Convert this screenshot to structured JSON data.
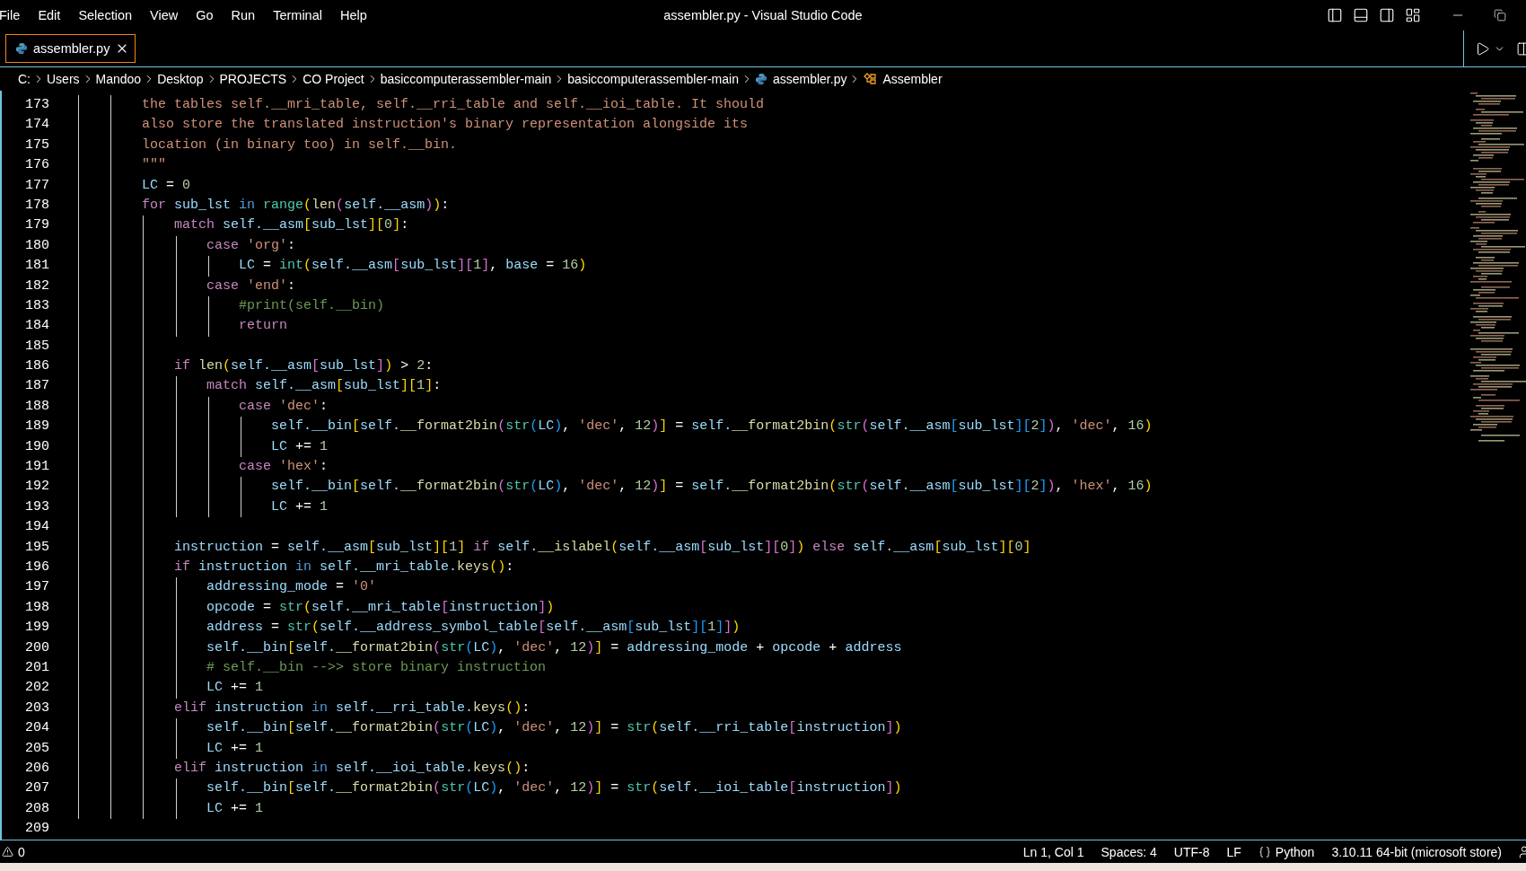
{
  "window": {
    "title": "assembler.py - Visual Studio Code"
  },
  "menu": [
    "File",
    "Edit",
    "Selection",
    "View",
    "Go",
    "Run",
    "Terminal",
    "Help"
  ],
  "tabs": [
    {
      "label": "assembler.py",
      "selected": true
    }
  ],
  "breadcrumb": [
    {
      "label": "C:",
      "kind": "folder"
    },
    {
      "label": "Users",
      "kind": "folder"
    },
    {
      "label": "Mandoo",
      "kind": "folder"
    },
    {
      "label": "Desktop",
      "kind": "folder"
    },
    {
      "label": "PROJECTS",
      "kind": "folder"
    },
    {
      "label": "CO Project",
      "kind": "folder"
    },
    {
      "label": "basiccomputerassembler-main",
      "kind": "folder"
    },
    {
      "label": "basiccomputerassembler-main",
      "kind": "folder"
    },
    {
      "label": "assembler.py",
      "kind": "file"
    },
    {
      "label": "Assembler",
      "kind": "class"
    }
  ],
  "editor": {
    "lines": [
      {
        "number": "173",
        "tokens": [
          {
            "kind": "doc",
            "text": "        the tables self.__mri_table, self.__rri_table and self.__ioi_table. It should"
          }
        ]
      },
      {
        "number": "174",
        "tokens": [
          {
            "kind": "doc",
            "text": "        also store the translated instruction's binary representation alongside its"
          }
        ]
      },
      {
        "number": "175",
        "tokens": [
          {
            "kind": "doc",
            "text": "        location (in binary too) in self.__bin."
          }
        ]
      },
      {
        "number": "176",
        "tokens": [
          {
            "kind": "doc",
            "text": "        \"\"\""
          }
        ]
      },
      {
        "number": "177",
        "tokens": [
          {
            "kind": "var",
            "text": "        LC"
          },
          {
            "kind": "p",
            "text": " = "
          },
          {
            "kind": "num",
            "text": "0"
          }
        ]
      },
      {
        "number": "178",
        "tokens": [
          {
            "kind": "kw",
            "text": "        for"
          },
          {
            "kind": "var",
            "text": " sub_lst "
          },
          {
            "kind": "in",
            "text": "in"
          },
          {
            "kind": "cls",
            "text": " range"
          },
          {
            "kind": "b1",
            "text": "("
          },
          {
            "kind": "fn",
            "text": "len"
          },
          {
            "kind": "b2",
            "text": "("
          },
          {
            "kind": "var",
            "text": "self.__asm"
          },
          {
            "kind": "b2",
            "text": ")"
          },
          {
            "kind": "b1",
            "text": ")"
          },
          {
            "kind": "p",
            "text": ":"
          }
        ]
      },
      {
        "number": "179",
        "tokens": [
          {
            "kind": "kw",
            "text": "            match"
          },
          {
            "kind": "var",
            "text": " self.__asm"
          },
          {
            "kind": "b1",
            "text": "["
          },
          {
            "kind": "var",
            "text": "sub_lst"
          },
          {
            "kind": "b1",
            "text": "]["
          },
          {
            "kind": "num",
            "text": "0"
          },
          {
            "kind": "b1",
            "text": "]"
          },
          {
            "kind": "p",
            "text": ":"
          }
        ]
      },
      {
        "number": "180",
        "tokens": [
          {
            "kind": "kw",
            "text": "                case"
          },
          {
            "kind": "str",
            "text": " 'org'"
          },
          {
            "kind": "p",
            "text": ":"
          }
        ]
      },
      {
        "number": "181",
        "tokens": [
          {
            "kind": "var",
            "text": "                    LC"
          },
          {
            "kind": "p",
            "text": " = "
          },
          {
            "kind": "cls",
            "text": "int"
          },
          {
            "kind": "b1",
            "text": "("
          },
          {
            "kind": "var",
            "text": "self.__asm"
          },
          {
            "kind": "b2",
            "text": "["
          },
          {
            "kind": "var",
            "text": "sub_lst"
          },
          {
            "kind": "b2",
            "text": "]["
          },
          {
            "kind": "num",
            "text": "1"
          },
          {
            "kind": "b2",
            "text": "]"
          },
          {
            "kind": "p",
            "text": ", "
          },
          {
            "kind": "var",
            "text": "base"
          },
          {
            "kind": "p",
            "text": " = "
          },
          {
            "kind": "num",
            "text": "16"
          },
          {
            "kind": "b1",
            "text": ")"
          }
        ]
      },
      {
        "number": "182",
        "tokens": [
          {
            "kind": "kw",
            "text": "                case"
          },
          {
            "kind": "str",
            "text": " 'end'"
          },
          {
            "kind": "p",
            "text": ":"
          }
        ]
      },
      {
        "number": "183",
        "tokens": [
          {
            "kind": "com",
            "text": "                    #print(self.__bin)"
          }
        ]
      },
      {
        "number": "184",
        "tokens": [
          {
            "kind": "kw",
            "text": "                    return"
          }
        ]
      },
      {
        "number": "185"
      },
      {
        "number": "186",
        "tokens": [
          {
            "kind": "kw",
            "text": "            if"
          },
          {
            "kind": "fn",
            "text": " len"
          },
          {
            "kind": "b1",
            "text": "("
          },
          {
            "kind": "var",
            "text": "self.__asm"
          },
          {
            "kind": "b2",
            "text": "["
          },
          {
            "kind": "var",
            "text": "sub_lst"
          },
          {
            "kind": "b2",
            "text": "]"
          },
          {
            "kind": "b1",
            "text": ")"
          },
          {
            "kind": "p",
            "text": " > "
          },
          {
            "kind": "num",
            "text": "2"
          },
          {
            "kind": "p",
            "text": ":"
          }
        ]
      },
      {
        "number": "187",
        "tokens": [
          {
            "kind": "kw",
            "text": "                match"
          },
          {
            "kind": "var",
            "text": " self.__asm"
          },
          {
            "kind": "b1",
            "text": "["
          },
          {
            "kind": "var",
            "text": "sub_lst"
          },
          {
            "kind": "b1",
            "text": "]["
          },
          {
            "kind": "num",
            "text": "1"
          },
          {
            "kind": "b1",
            "text": "]"
          },
          {
            "kind": "p",
            "text": ":"
          }
        ]
      },
      {
        "number": "188",
        "tokens": [
          {
            "kind": "kw",
            "text": "                    case"
          },
          {
            "kind": "str",
            "text": " 'dec'"
          },
          {
            "kind": "p",
            "text": ":"
          }
        ]
      },
      {
        "number": "189",
        "tokens": [
          {
            "kind": "var",
            "text": "                        self.__bin"
          },
          {
            "kind": "b1",
            "text": "["
          },
          {
            "kind": "var",
            "text": "self."
          },
          {
            "kind": "fn",
            "text": "__format2bin"
          },
          {
            "kind": "b2",
            "text": "("
          },
          {
            "kind": "cls",
            "text": "str"
          },
          {
            "kind": "b3",
            "text": "("
          },
          {
            "kind": "var",
            "text": "LC"
          },
          {
            "kind": "b3",
            "text": ")"
          },
          {
            "kind": "p",
            "text": ", "
          },
          {
            "kind": "str",
            "text": "'dec'"
          },
          {
            "kind": "p",
            "text": ", "
          },
          {
            "kind": "num",
            "text": "12"
          },
          {
            "kind": "b2",
            "text": ")"
          },
          {
            "kind": "b1",
            "text": "]"
          },
          {
            "kind": "p",
            "text": " = "
          },
          {
            "kind": "var",
            "text": "self."
          },
          {
            "kind": "fn",
            "text": "__format2bin"
          },
          {
            "kind": "b1",
            "text": "("
          },
          {
            "kind": "cls",
            "text": "str"
          },
          {
            "kind": "b2",
            "text": "("
          },
          {
            "kind": "var",
            "text": "self.__asm"
          },
          {
            "kind": "b3",
            "text": "["
          },
          {
            "kind": "var",
            "text": "sub_lst"
          },
          {
            "kind": "b3",
            "text": "]["
          },
          {
            "kind": "num",
            "text": "2"
          },
          {
            "kind": "b3",
            "text": "]"
          },
          {
            "kind": "b2",
            "text": ")"
          },
          {
            "kind": "p",
            "text": ", "
          },
          {
            "kind": "str",
            "text": "'dec'"
          },
          {
            "kind": "p",
            "text": ", "
          },
          {
            "kind": "num",
            "text": "16"
          },
          {
            "kind": "b1",
            "text": ")"
          }
        ]
      },
      {
        "number": "190",
        "tokens": [
          {
            "kind": "var",
            "text": "                        LC"
          },
          {
            "kind": "p",
            "text": " += "
          },
          {
            "kind": "num",
            "text": "1"
          }
        ]
      },
      {
        "number": "191",
        "tokens": [
          {
            "kind": "kw",
            "text": "                    case"
          },
          {
            "kind": "str",
            "text": " 'hex'"
          },
          {
            "kind": "p",
            "text": ":"
          }
        ]
      },
      {
        "number": "192",
        "tokens": [
          {
            "kind": "var",
            "text": "                        self.__bin"
          },
          {
            "kind": "b1",
            "text": "["
          },
          {
            "kind": "var",
            "text": "self."
          },
          {
            "kind": "fn",
            "text": "__format2bin"
          },
          {
            "kind": "b2",
            "text": "("
          },
          {
            "kind": "cls",
            "text": "str"
          },
          {
            "kind": "b3",
            "text": "("
          },
          {
            "kind": "var",
            "text": "LC"
          },
          {
            "kind": "b3",
            "text": ")"
          },
          {
            "kind": "p",
            "text": ", "
          },
          {
            "kind": "str",
            "text": "'dec'"
          },
          {
            "kind": "p",
            "text": ", "
          },
          {
            "kind": "num",
            "text": "12"
          },
          {
            "kind": "b2",
            "text": ")"
          },
          {
            "kind": "b1",
            "text": "]"
          },
          {
            "kind": "p",
            "text": " = "
          },
          {
            "kind": "var",
            "text": "self."
          },
          {
            "kind": "fn",
            "text": "__format2bin"
          },
          {
            "kind": "b1",
            "text": "("
          },
          {
            "kind": "cls",
            "text": "str"
          },
          {
            "kind": "b2",
            "text": "("
          },
          {
            "kind": "var",
            "text": "self.__asm"
          },
          {
            "kind": "b3",
            "text": "["
          },
          {
            "kind": "var",
            "text": "sub_lst"
          },
          {
            "kind": "b3",
            "text": "]["
          },
          {
            "kind": "num",
            "text": "2"
          },
          {
            "kind": "b3",
            "text": "]"
          },
          {
            "kind": "b2",
            "text": ")"
          },
          {
            "kind": "p",
            "text": ", "
          },
          {
            "kind": "str",
            "text": "'hex'"
          },
          {
            "kind": "p",
            "text": ", "
          },
          {
            "kind": "num",
            "text": "16"
          },
          {
            "kind": "b1",
            "text": ")"
          }
        ]
      },
      {
        "number": "193",
        "tokens": [
          {
            "kind": "var",
            "text": "                        LC"
          },
          {
            "kind": "p",
            "text": " += "
          },
          {
            "kind": "num",
            "text": "1"
          }
        ]
      },
      {
        "number": "194"
      },
      {
        "number": "195",
        "tokens": [
          {
            "kind": "var",
            "text": "            instruction"
          },
          {
            "kind": "p",
            "text": " = "
          },
          {
            "kind": "var",
            "text": "self.__asm"
          },
          {
            "kind": "b1",
            "text": "["
          },
          {
            "kind": "var",
            "text": "sub_lst"
          },
          {
            "kind": "b1",
            "text": "]["
          },
          {
            "kind": "num",
            "text": "1"
          },
          {
            "kind": "b1",
            "text": "]"
          },
          {
            "kind": "kw",
            "text": " if"
          },
          {
            "kind": "var",
            "text": " self."
          },
          {
            "kind": "fn",
            "text": "__islabel"
          },
          {
            "kind": "b1",
            "text": "("
          },
          {
            "kind": "var",
            "text": "self.__asm"
          },
          {
            "kind": "b2",
            "text": "["
          },
          {
            "kind": "var",
            "text": "sub_lst"
          },
          {
            "kind": "b2",
            "text": "]["
          },
          {
            "kind": "num",
            "text": "0"
          },
          {
            "kind": "b2",
            "text": "]"
          },
          {
            "kind": "b1",
            "text": ")"
          },
          {
            "kind": "kw",
            "text": " else"
          },
          {
            "kind": "var",
            "text": " self.__asm"
          },
          {
            "kind": "b1",
            "text": "["
          },
          {
            "kind": "var",
            "text": "sub_lst"
          },
          {
            "kind": "b1",
            "text": "]["
          },
          {
            "kind": "num",
            "text": "0"
          },
          {
            "kind": "b1",
            "text": "]"
          }
        ]
      },
      {
        "number": "196",
        "tokens": [
          {
            "kind": "kw",
            "text": "            if"
          },
          {
            "kind": "var",
            "text": " instruction "
          },
          {
            "kind": "in",
            "text": "in"
          },
          {
            "kind": "var",
            "text": " self.__mri_table."
          },
          {
            "kind": "fn",
            "text": "keys"
          },
          {
            "kind": "b1",
            "text": "()"
          },
          {
            "kind": "p",
            "text": ":"
          }
        ]
      },
      {
        "number": "197",
        "tokens": [
          {
            "kind": "var",
            "text": "                addressing_mode"
          },
          {
            "kind": "p",
            "text": " = "
          },
          {
            "kind": "str",
            "text": "'0'"
          }
        ]
      },
      {
        "number": "198",
        "tokens": [
          {
            "kind": "var",
            "text": "                opcode"
          },
          {
            "kind": "p",
            "text": " = "
          },
          {
            "kind": "cls",
            "text": "str"
          },
          {
            "kind": "b1",
            "text": "("
          },
          {
            "kind": "var",
            "text": "self.__mri_table"
          },
          {
            "kind": "b2",
            "text": "["
          },
          {
            "kind": "var",
            "text": "instruction"
          },
          {
            "kind": "b2",
            "text": "]"
          },
          {
            "kind": "b1",
            "text": ")"
          }
        ]
      },
      {
        "number": "199",
        "tokens": [
          {
            "kind": "var",
            "text": "                address"
          },
          {
            "kind": "p",
            "text": " = "
          },
          {
            "kind": "cls",
            "text": "str"
          },
          {
            "kind": "b1",
            "text": "("
          },
          {
            "kind": "var",
            "text": "self.__address_symbol_table"
          },
          {
            "kind": "b2",
            "text": "["
          },
          {
            "kind": "var",
            "text": "self.__asm"
          },
          {
            "kind": "b3",
            "text": "["
          },
          {
            "kind": "var",
            "text": "sub_lst"
          },
          {
            "kind": "b3",
            "text": "]["
          },
          {
            "kind": "num",
            "text": "1"
          },
          {
            "kind": "b3",
            "text": "]"
          },
          {
            "kind": "b2",
            "text": "]"
          },
          {
            "kind": "b1",
            "text": ")"
          }
        ]
      },
      {
        "number": "200",
        "tokens": [
          {
            "kind": "var",
            "text": "                self.__bin"
          },
          {
            "kind": "b1",
            "text": "["
          },
          {
            "kind": "var",
            "text": "self."
          },
          {
            "kind": "fn",
            "text": "__format2bin"
          },
          {
            "kind": "b2",
            "text": "("
          },
          {
            "kind": "cls",
            "text": "str"
          },
          {
            "kind": "b3",
            "text": "("
          },
          {
            "kind": "var",
            "text": "LC"
          },
          {
            "kind": "b3",
            "text": ")"
          },
          {
            "kind": "p",
            "text": ", "
          },
          {
            "kind": "str",
            "text": "'dec'"
          },
          {
            "kind": "p",
            "text": ", "
          },
          {
            "kind": "num",
            "text": "12"
          },
          {
            "kind": "b2",
            "text": ")"
          },
          {
            "kind": "b1",
            "text": "]"
          },
          {
            "kind": "p",
            "text": " = "
          },
          {
            "kind": "var",
            "text": "addressing_mode"
          },
          {
            "kind": "p",
            "text": " + "
          },
          {
            "kind": "var",
            "text": "opcode"
          },
          {
            "kind": "p",
            "text": " + "
          },
          {
            "kind": "var",
            "text": "address"
          }
        ]
      },
      {
        "number": "201",
        "tokens": [
          {
            "kind": "com",
            "text": "                # self.__bin -->> store binary instruction"
          }
        ]
      },
      {
        "number": "202",
        "tokens": [
          {
            "kind": "var",
            "text": "                LC"
          },
          {
            "kind": "p",
            "text": " += "
          },
          {
            "kind": "num",
            "text": "1"
          }
        ]
      },
      {
        "number": "203",
        "tokens": [
          {
            "kind": "kw",
            "text": "            elif"
          },
          {
            "kind": "var",
            "text": " instruction "
          },
          {
            "kind": "in",
            "text": "in"
          },
          {
            "kind": "var",
            "text": " self.__rri_table."
          },
          {
            "kind": "fn",
            "text": "keys"
          },
          {
            "kind": "b1",
            "text": "()"
          },
          {
            "kind": "p",
            "text": ":"
          }
        ]
      },
      {
        "number": "204",
        "tokens": [
          {
            "kind": "var",
            "text": "                self.__bin"
          },
          {
            "kind": "b1",
            "text": "["
          },
          {
            "kind": "var",
            "text": "self."
          },
          {
            "kind": "fn",
            "text": "__format2bin"
          },
          {
            "kind": "b2",
            "text": "("
          },
          {
            "kind": "cls",
            "text": "str"
          },
          {
            "kind": "b3",
            "text": "("
          },
          {
            "kind": "var",
            "text": "LC"
          },
          {
            "kind": "b3",
            "text": ")"
          },
          {
            "kind": "p",
            "text": ", "
          },
          {
            "kind": "str",
            "text": "'dec'"
          },
          {
            "kind": "p",
            "text": ", "
          },
          {
            "kind": "num",
            "text": "12"
          },
          {
            "kind": "b2",
            "text": ")"
          },
          {
            "kind": "b1",
            "text": "]"
          },
          {
            "kind": "p",
            "text": " = "
          },
          {
            "kind": "cls",
            "text": "str"
          },
          {
            "kind": "b1",
            "text": "("
          },
          {
            "kind": "var",
            "text": "self.__rri_table"
          },
          {
            "kind": "b2",
            "text": "["
          },
          {
            "kind": "var",
            "text": "instruction"
          },
          {
            "kind": "b2",
            "text": "]"
          },
          {
            "kind": "b1",
            "text": ")"
          }
        ]
      },
      {
        "number": "205",
        "tokens": [
          {
            "kind": "var",
            "text": "                LC"
          },
          {
            "kind": "p",
            "text": " += "
          },
          {
            "kind": "num",
            "text": "1"
          }
        ]
      },
      {
        "number": "206",
        "tokens": [
          {
            "kind": "kw",
            "text": "            elif"
          },
          {
            "kind": "var",
            "text": " instruction "
          },
          {
            "kind": "in",
            "text": "in"
          },
          {
            "kind": "var",
            "text": " self.__ioi_table."
          },
          {
            "kind": "fn",
            "text": "keys"
          },
          {
            "kind": "b1",
            "text": "()"
          },
          {
            "kind": "p",
            "text": ":"
          }
        ]
      },
      {
        "number": "207",
        "tokens": [
          {
            "kind": "var",
            "text": "                self.__bin"
          },
          {
            "kind": "b1",
            "text": "["
          },
          {
            "kind": "var",
            "text": "self."
          },
          {
            "kind": "fn",
            "text": "__format2bin"
          },
          {
            "kind": "b2",
            "text": "("
          },
          {
            "kind": "cls",
            "text": "str"
          },
          {
            "kind": "b3",
            "text": "("
          },
          {
            "kind": "var",
            "text": "LC"
          },
          {
            "kind": "b3",
            "text": ")"
          },
          {
            "kind": "p",
            "text": ", "
          },
          {
            "kind": "str",
            "text": "'dec'"
          },
          {
            "kind": "p",
            "text": ", "
          },
          {
            "kind": "num",
            "text": "12"
          },
          {
            "kind": "b2",
            "text": ")"
          },
          {
            "kind": "b1",
            "text": "]"
          },
          {
            "kind": "p",
            "text": " = "
          },
          {
            "kind": "cls",
            "text": "str"
          },
          {
            "kind": "b1",
            "text": "("
          },
          {
            "kind": "var",
            "text": "self.__ioi_table"
          },
          {
            "kind": "b2",
            "text": "["
          },
          {
            "kind": "var",
            "text": "instruction"
          },
          {
            "kind": "b2",
            "text": "]"
          },
          {
            "kind": "b1",
            "text": ")"
          }
        ]
      },
      {
        "number": "208",
        "tokens": [
          {
            "kind": "var",
            "text": "                LC"
          },
          {
            "kind": "p",
            "text": " += "
          },
          {
            "kind": "num",
            "text": "1"
          }
        ]
      },
      {
        "number": "209"
      }
    ]
  },
  "status_bar": {
    "problems": "0",
    "items": [
      {
        "kind": "text",
        "label": "Ln 1, Col 1"
      },
      {
        "kind": "text",
        "label": "Spaces: 4"
      },
      {
        "kind": "text",
        "label": "UTF-8"
      },
      {
        "kind": "text",
        "label": "LF"
      },
      {
        "kind": "language",
        "label": "Python"
      },
      {
        "kind": "text",
        "label": "3.10.11 64-bit (microsoft store)"
      }
    ]
  }
}
